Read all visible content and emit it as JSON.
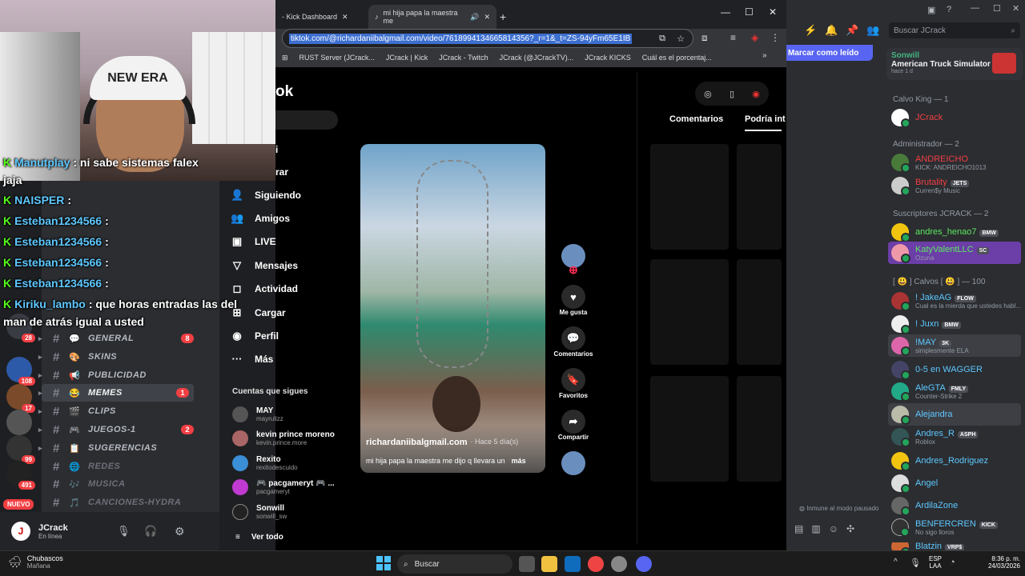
{
  "webcam": {
    "cap_text": "NEW ERA"
  },
  "chat": [
    {
      "user": "Manutplay",
      "text": ": ni sabe sistemas falex"
    },
    {
      "user": "",
      "text": "jaja"
    },
    {
      "user": "NAISPER",
      "text": ":"
    },
    {
      "user": "Esteban1234566",
      "text": ":"
    },
    {
      "user": "Esteban1234566",
      "text": ":"
    },
    {
      "user": "Esteban1234566",
      "text": ":"
    },
    {
      "user": "Esteban1234566",
      "text": ":"
    },
    {
      "user": "Kiriku_lambo",
      "text": ": que horas entradas las del"
    },
    {
      "user": "",
      "text": "man de atrás igual a usted"
    }
  ],
  "servers": [
    {
      "badge": ""
    },
    {
      "badge": "28"
    },
    {
      "badge": "108"
    },
    {
      "badge": "17"
    },
    {
      "badge": ""
    },
    {
      "badge": "99"
    },
    {
      "badge": "491"
    },
    {
      "badge": ""
    }
  ],
  "server_new_label": "NUEVO",
  "channels": [
    {
      "emoji": "💬",
      "name": "GENERAL",
      "badge": "8"
    },
    {
      "emoji": "🎨",
      "name": "SKINS",
      "badge": ""
    },
    {
      "emoji": "📢",
      "name": "PUBLICIDAD",
      "badge": ""
    },
    {
      "emoji": "😂",
      "name": "MEMES",
      "badge": "1"
    },
    {
      "emoji": "🎬",
      "name": "CLIPS",
      "badge": ""
    },
    {
      "emoji": "🎮",
      "name": "JUEGOS-1",
      "badge": "2"
    },
    {
      "emoji": "📋",
      "name": "SUGERENCIAS",
      "badge": ""
    },
    {
      "emoji": "🌐",
      "name": "REDES",
      "badge": ""
    },
    {
      "emoji": "🎶",
      "name": "MUSICA",
      "badge": ""
    },
    {
      "emoji": "🎵",
      "name": "CANCIONES-HYDRA",
      "badge": ""
    }
  ],
  "user": {
    "name": "JCrack",
    "status": "En línea"
  },
  "browser": {
    "tabs": [
      "- Kick Dashboard",
      "mi hija papa la maestra me"
    ],
    "url": "tiktok.com/@richardaniibalgmail.com/video/7618994134665814356?_r=1&_t=ZS-94yFm65E1IB",
    "bookmarks": [
      "RUST Server (JCrack...",
      "JCrack | Kick",
      "JCrack - Twitch",
      "JCrack (@JCrackTV)...",
      "JCrack KICKS",
      "Cuál es el porcentaj..."
    ]
  },
  "tiktok": {
    "logo": "ok",
    "nav_partial": [
      "i",
      "rar"
    ],
    "nav": [
      {
        "icon": "👤",
        "label": "Siguiendo"
      },
      {
        "icon": "👥",
        "label": "Amigos"
      },
      {
        "icon": "▣",
        "label": "LIVE"
      },
      {
        "icon": "▽",
        "label": "Mensajes"
      },
      {
        "icon": "◻",
        "label": "Actividad"
      },
      {
        "icon": "⊞",
        "label": "Cargar"
      },
      {
        "icon": "◉",
        "label": "Perfil"
      },
      {
        "icon": "···",
        "label": "Más"
      }
    ],
    "following_title": "Cuentas que sigues",
    "accounts": [
      {
        "name": "MAY",
        "handle": "mayrulizz"
      },
      {
        "name": "kevin prince moreno",
        "handle": "kevin.prince.more"
      },
      {
        "name": "Rexito",
        "handle": "rexitodescuido"
      },
      {
        "name": "🎮 pacgameryt 🎮 ...",
        "handle": "pacgameryt"
      },
      {
        "name": "Sonwill",
        "handle": "sonwill_sw"
      }
    ],
    "see_all": "Ver todo",
    "video": {
      "author": "richardaniibalgmail.com",
      "time": "· Hace 5 día(s)",
      "caption": "mi hija papa la maestra me dijo q llevara un",
      "more": "más"
    },
    "actions": [
      "Me gusta",
      "Comentarios",
      "Favoritos",
      "Compartir"
    ],
    "panel_tabs": [
      "Comentarios",
      "Podría int"
    ]
  },
  "members": {
    "mark_read": "Marcar como leído",
    "search_placeholder": "Buscar JCrack",
    "activity": {
      "name": "Sonwill",
      "game": "American Truck Simulator",
      "time": "hace 1 d"
    },
    "sections": [
      "Calvo King — 1",
      "Administrador — 2",
      "Suscriptores JCRACK — 2",
      "[ 😃 ] Calvos [ 😃 ] — 100"
    ],
    "calvo_king": [
      {
        "name": "JCrack",
        "sub": "",
        "tag": ""
      }
    ],
    "admins": [
      {
        "name": "ANDREICHO",
        "sub": "KICK: ANDREICHO1013",
        "tag": ""
      },
      {
        "name": "Brutality",
        "sub": "Curren$y Music",
        "tag": "JETS"
      }
    ],
    "subs": [
      {
        "name": "andres_henao7",
        "sub": "",
        "tag": "BMW"
      },
      {
        "name": "KatyValentLLC",
        "sub": "Ozuna",
        "tag": "SC"
      }
    ],
    "calvos": [
      {
        "name": "! JakeAG",
        "sub": "Cual es la mierda que ustedes habl...",
        "tag": "FLOW"
      },
      {
        "name": "! Juxn",
        "sub": "",
        "tag": "BMW"
      },
      {
        "name": "!MAY",
        "sub": "simplesmente ELA",
        "tag": "3K"
      },
      {
        "name": "0-5 en WAGGER",
        "sub": "",
        "tag": ""
      },
      {
        "name": "AleGTA",
        "sub": "Counter-Strike 2",
        "tag": "FMLY"
      },
      {
        "name": "Alejandra",
        "sub": "",
        "tag": ""
      },
      {
        "name": "Andres_R",
        "sub": "Roblox",
        "tag": "ASPH"
      },
      {
        "name": "Andres_Rodriguez",
        "sub": "",
        "tag": ""
      },
      {
        "name": "Angel",
        "sub": "",
        "tag": ""
      },
      {
        "name": "ArdilaZone",
        "sub": "",
        "tag": ""
      },
      {
        "name": "BENFERCREN",
        "sub": "No sigo lloros",
        "tag": "KICK"
      },
      {
        "name": "Blatzin",
        "sub": "",
        "tag": "VRP$"
      }
    ],
    "paused_note": "Inmune al modo pausado"
  },
  "taskbar": {
    "weather": "Chubascos",
    "weather_sub": "Mañana",
    "search": "Buscar",
    "lang": "ESP",
    "lang_sub": "LAA",
    "time": "8:36 p. m.",
    "date": "24/03/2026"
  }
}
